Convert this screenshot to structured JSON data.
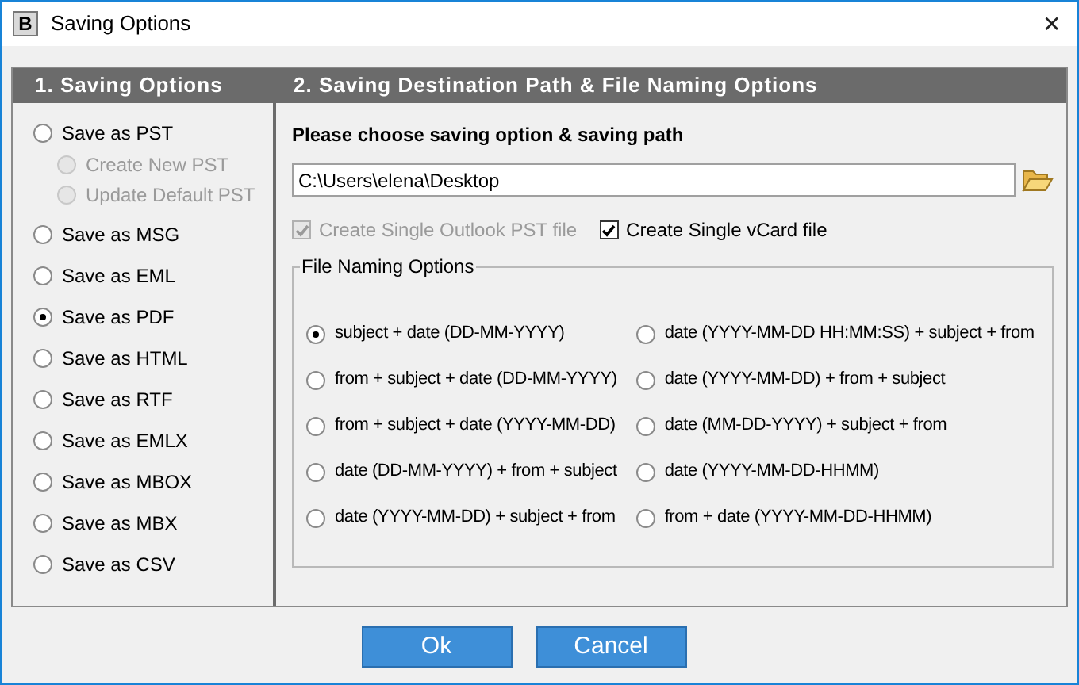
{
  "window": {
    "title": "Saving Options",
    "app_icon_letter": "B",
    "close": "✕"
  },
  "left_panel": {
    "header": "1. Saving Options",
    "options": [
      {
        "label": "Save as PST",
        "selected": false,
        "disabled": false,
        "children": [
          {
            "label": "Create New PST",
            "selected": false,
            "disabled": true
          },
          {
            "label": "Update Default PST",
            "selected": false,
            "disabled": true
          }
        ]
      },
      {
        "label": "Save as MSG",
        "selected": false,
        "disabled": false
      },
      {
        "label": "Save as EML",
        "selected": false,
        "disabled": false
      },
      {
        "label": "Save as PDF",
        "selected": true,
        "disabled": false
      },
      {
        "label": "Save as HTML",
        "selected": false,
        "disabled": false
      },
      {
        "label": "Save as RTF",
        "selected": false,
        "disabled": false
      },
      {
        "label": "Save as EMLX",
        "selected": false,
        "disabled": false
      },
      {
        "label": "Save as MBOX",
        "selected": false,
        "disabled": false
      },
      {
        "label": "Save as MBX",
        "selected": false,
        "disabled": false
      },
      {
        "label": "Save as CSV",
        "selected": false,
        "disabled": false
      }
    ]
  },
  "right_panel": {
    "header": "2. Saving Destination Path & File Naming Options",
    "prompt": "Please choose saving option & saving path",
    "path": "C:\\Users\\elena\\Desktop",
    "checkboxes": [
      {
        "label": "Create Single Outlook PST file",
        "checked": true,
        "disabled": true
      },
      {
        "label": "Create Single vCard file",
        "checked": true,
        "disabled": false
      }
    ],
    "naming": {
      "legend": "File Naming Options",
      "columns": [
        {
          "options": [
            {
              "label": "subject + date (DD-MM-YYYY)",
              "selected": true
            },
            {
              "label": "from + subject + date (DD-MM-YYYY)",
              "selected": false
            },
            {
              "label": "from + subject + date (YYYY-MM-DD)",
              "selected": false
            },
            {
              "label": "date (DD-MM-YYYY) + from + subject",
              "selected": false
            },
            {
              "label": "date (YYYY-MM-DD) + subject + from",
              "selected": false
            }
          ]
        },
        {
          "options": [
            {
              "label": "date (YYYY-MM-DD HH:MM:SS) + subject + from",
              "selected": false
            },
            {
              "label": "date (YYYY-MM-DD) + from + subject",
              "selected": false
            },
            {
              "label": "date (MM-DD-YYYY) + subject + from",
              "selected": false
            },
            {
              "label": "date (YYYY-MM-DD-HHMM)",
              "selected": false
            },
            {
              "label": "from + date (YYYY-MM-DD-HHMM)",
              "selected": false
            }
          ]
        }
      ]
    }
  },
  "buttons": [
    "Ok",
    "Cancel"
  ]
}
